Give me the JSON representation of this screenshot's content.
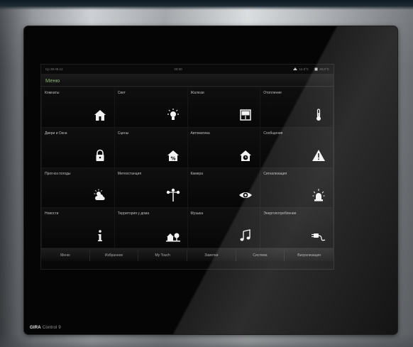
{
  "status": {
    "date_time": "Ср 29.09.12",
    "clock": "20:30",
    "outdoor_temp": "12,0°C",
    "indoor_temp": "20,0°C"
  },
  "header": {
    "title": "Меню"
  },
  "tiles": [
    {
      "label": "Комнаты",
      "icon": "house-icon"
    },
    {
      "label": "Свет",
      "icon": "bulb-icon"
    },
    {
      "label": "Жалюзи",
      "icon": "blinds-icon"
    },
    {
      "label": "Отопление",
      "icon": "thermometer-icon"
    },
    {
      "label": "Двери и Окна",
      "icon": "lock-icon"
    },
    {
      "label": "Сцены",
      "icon": "house-percent-icon"
    },
    {
      "label": "Автоматика",
      "icon": "house-clock-icon"
    },
    {
      "label": "Сообщения",
      "icon": "warning-icon"
    },
    {
      "label": "Прогноз погоды",
      "icon": "weather-icon"
    },
    {
      "label": "Метеостанция",
      "icon": "anemometer-icon"
    },
    {
      "label": "Камера",
      "icon": "eye-icon"
    },
    {
      "label": "Сигнализация",
      "icon": "alarm-icon"
    },
    {
      "label": "Новости",
      "icon": "info-icon"
    },
    {
      "label": "Территория у дома",
      "icon": "garden-icon"
    },
    {
      "label": "Музыка",
      "icon": "music-icon"
    },
    {
      "label": "Энергопотребление",
      "icon": "plug-icon"
    }
  ],
  "nav": [
    "Меню",
    "Избранное",
    "My Touch",
    "Заметки",
    "Система",
    "Визуализация"
  ],
  "brand": {
    "name": "GIRA",
    "product": "Control 9"
  }
}
